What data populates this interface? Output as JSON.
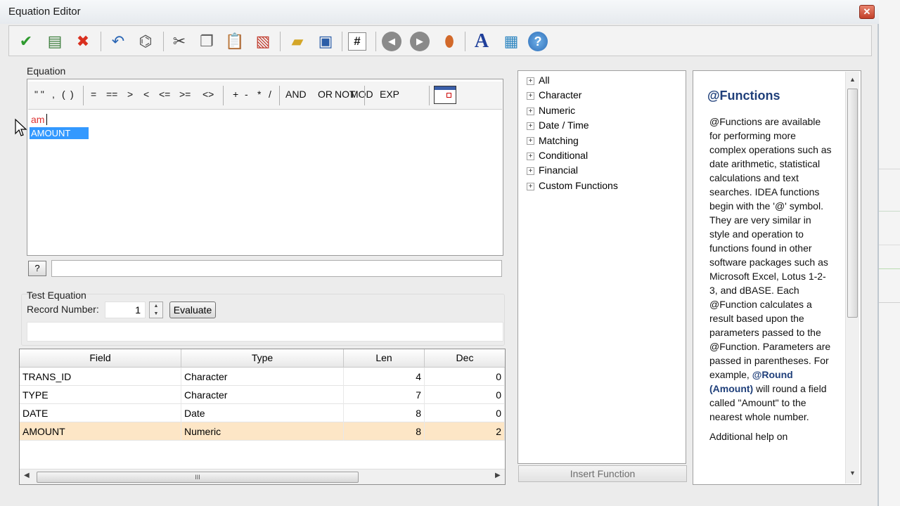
{
  "window": {
    "title": "Equation Editor",
    "close": "✕"
  },
  "toolbar": {
    "buttons": [
      {
        "name": "ok-icon",
        "glyph": "✔",
        "color": "#2e9a2e"
      },
      {
        "name": "validate-icon",
        "glyph": "▤",
        "color": "#3c7d3c"
      },
      {
        "name": "cancel-icon",
        "glyph": "✖",
        "color": "#d9301f"
      },
      {
        "name": "undo-icon",
        "glyph": "↶",
        "color": "#2c67b5"
      },
      {
        "name": "binoculars-icon",
        "glyph": "⌬",
        "color": "#555555"
      },
      {
        "name": "cut-icon",
        "glyph": "✂",
        "color": "#444444"
      },
      {
        "name": "copy-icon",
        "glyph": "❐",
        "color": "#5a5a5a"
      },
      {
        "name": "paste-icon",
        "glyph": "📋",
        "color": "#9c7a2a"
      },
      {
        "name": "delete-icon",
        "glyph": "▧",
        "color": "#c0392b"
      },
      {
        "name": "open-folder-icon",
        "glyph": "▰",
        "color": "#d4a628"
      },
      {
        "name": "save-icon",
        "glyph": "▣",
        "color": "#2c5ea8"
      },
      {
        "name": "number-icon",
        "glyph": "#",
        "color": "#1a1a1a"
      },
      {
        "name": "back-icon",
        "glyph": "◀",
        "color": "#6b6b6b"
      },
      {
        "name": "forward-icon",
        "glyph": "▶",
        "color": "#6b6b6b"
      },
      {
        "name": "pin-icon",
        "glyph": "⬮",
        "color": "#d2692a"
      },
      {
        "name": "font-icon",
        "glyph": "A",
        "color": "#1f3f9a"
      },
      {
        "name": "window-help-icon",
        "glyph": "▦",
        "color": "#2e86c1"
      },
      {
        "name": "help-icon",
        "glyph": "?",
        "color": "#ffffff"
      }
    ]
  },
  "equation": {
    "label": "Equation",
    "operators": [
      "\" \"",
      ",",
      "(",
      ")",
      "=",
      "==",
      ">",
      "<",
      "<=",
      ">=",
      "<>",
      "+",
      "-",
      "*",
      "/",
      "AND",
      "OR",
      "NOT",
      "MOD",
      "EXP"
    ],
    "text": "am",
    "suggestion": "AMOUNT",
    "help_button": "?"
  },
  "test": {
    "label": "Test Equation",
    "record_label": "Record Number:",
    "record_value": "1",
    "evaluate_label": "Evaluate"
  },
  "fields_table": {
    "columns": [
      "Field",
      "Type",
      "Len",
      "Dec"
    ],
    "rows": [
      {
        "field": "TRANS_ID",
        "type": "Character",
        "len": "4",
        "dec": "0"
      },
      {
        "field": "TYPE",
        "type": "Character",
        "len": "7",
        "dec": "0"
      },
      {
        "field": "DATE",
        "type": "Date",
        "len": "8",
        "dec": "0"
      },
      {
        "field": "AMOUNT",
        "type": "Numeric",
        "len": "8",
        "dec": "2"
      }
    ],
    "selected_row": 3,
    "scroll_thumb": "III"
  },
  "functions_tree": {
    "items": [
      "All",
      "Character",
      "Numeric",
      "Date / Time",
      "Matching",
      "Conditional",
      "Financial",
      "Custom Functions"
    ],
    "insert_label": "Insert Function"
  },
  "help_panel": {
    "title": "@Functions",
    "body_1": "@Functions are available for performing more complex operations such as date arithmetic, statistical calculations and text searches. IDEA functions begin with the '@' symbol. They are very similar in style and operation to functions found in other software packages such as Microsoft Excel, Lotus 1-2-3, and dBASE. Each @Function calculates a result based upon the parameters passed to the @Function. Parameters are passed in parentheses. For example, ",
    "example": "@Round (Amount)",
    "body_2": " will round a field called \"Amount\" to the nearest whole number.",
    "more": "Additional help on"
  }
}
